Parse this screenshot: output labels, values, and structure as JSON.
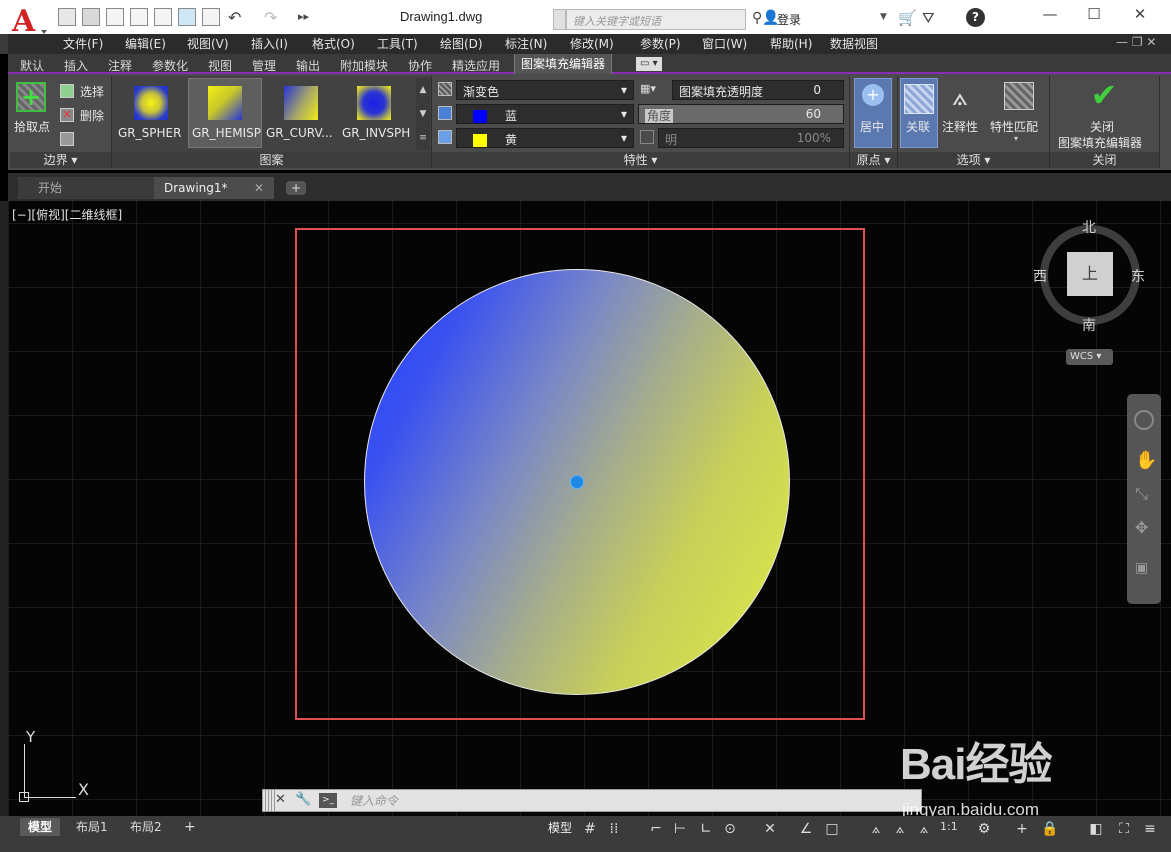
{
  "window": {
    "title": "Drawing1.dwg",
    "search_placeholder": "键入关键字或短语",
    "login_label": "登录"
  },
  "menu": [
    "文件(F)",
    "编辑(E)",
    "视图(V)",
    "插入(I)",
    "格式(O)",
    "工具(T)",
    "绘图(D)",
    "标注(N)",
    "修改(M)",
    "参数(P)",
    "窗口(W)",
    "帮助(H)",
    "数据视图"
  ],
  "ribbon_tabs": [
    "默认",
    "插入",
    "注释",
    "参数化",
    "视图",
    "管理",
    "输出",
    "附加模块",
    "协作",
    "精选应用",
    "图案填充编辑器"
  ],
  "ribbon": {
    "boundary": {
      "pick_points": "拾取点",
      "select": "选择",
      "remove": "删除",
      "title": "边界"
    },
    "pattern": {
      "items": [
        "GR_SPHER",
        "GR_HEMISP",
        "GR_CURV...",
        "GR_INVSPH"
      ],
      "title": "图案"
    },
    "properties": {
      "type": "渐变色",
      "color1": "蓝",
      "color2": "黄",
      "transparency_label": "图案填充透明度",
      "transparency_value": "0",
      "angle_label": "角度",
      "angle_value": "60",
      "tint_label": "明",
      "tint_value": "100%",
      "title": "特性"
    },
    "origin": {
      "center": "居中",
      "title": "原点"
    },
    "options": {
      "associative": "关联",
      "annotative": "注释性",
      "match": "特性匹配",
      "title": "选项"
    },
    "close": {
      "label1": "关闭",
      "label2": "图案填充编辑器",
      "title": "关闭"
    }
  },
  "doc_tabs": [
    "开始",
    "Drawing1*"
  ],
  "viewport_label": "[−][俯视][二维线框]",
  "viewcube": {
    "north": "北",
    "south": "南",
    "east": "东",
    "west": "西",
    "top": "上",
    "wcs": "WCS"
  },
  "ucs": {
    "x": "X",
    "y": "Y"
  },
  "command_placeholder": "键入命令",
  "layout_tabs": [
    "模型",
    "布局1",
    "布局2"
  ],
  "status": {
    "model": "模型",
    "scale": "1:1"
  },
  "watermark": {
    "brand": "Bai经验",
    "url": "jingyan.baidu.com"
  },
  "colors": {
    "gradient_start": "#1f3cff",
    "gradient_end": "#d6e04e",
    "boundary": "#e05050",
    "accent_tab": "#8a2bb3"
  }
}
